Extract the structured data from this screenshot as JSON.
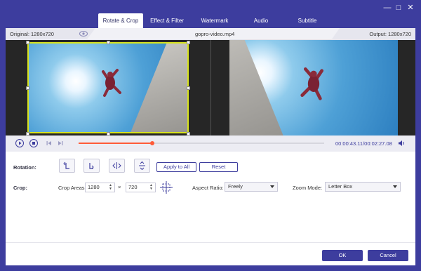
{
  "tabs": [
    {
      "label": "Rotate & Crop",
      "active": true
    },
    {
      "label": "Effect & Filter",
      "active": false
    },
    {
      "label": "Watermark",
      "active": false
    },
    {
      "label": "Audio",
      "active": false
    },
    {
      "label": "Subtitle",
      "active": false
    }
  ],
  "info": {
    "original": "Original: 1280x720",
    "filename": "gopro-video.mp4",
    "output": "Output: 1280x720"
  },
  "player": {
    "current_time": "00:00:43.11",
    "total_time": "/00:02:27.08",
    "progress_fraction": 0.3
  },
  "rotation": {
    "label": "Rotation:",
    "apply_all": "Apply to All",
    "reset": "Reset"
  },
  "crop": {
    "label": "Crop:",
    "area_label": "Crop Areas:",
    "width": "1280",
    "times": "×",
    "height": "720",
    "aspect_label": "Aspect Ratio:",
    "aspect_value": "Freely",
    "zoom_label": "Zoom Mode:",
    "zoom_value": "Letter Box"
  },
  "footer": {
    "ok": "OK",
    "cancel": "Cancel"
  },
  "colors": {
    "accent": "#3d3d9e",
    "progress": "#ff5b38",
    "crop_border": "#d7e21d"
  }
}
